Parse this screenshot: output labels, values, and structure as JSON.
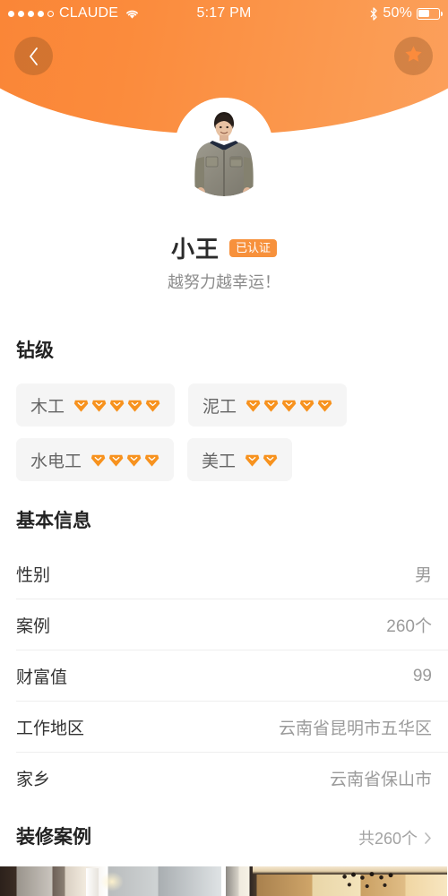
{
  "statusbar": {
    "signal_dots_filled": 4,
    "signal_dots_total": 5,
    "carrier": "CLAUDE",
    "wifi_icon": "wifi-icon",
    "time": "5:17 PM",
    "bluetooth_icon": "bluetooth-icon",
    "battery_percent": "50%",
    "battery_level": 50
  },
  "header": {
    "back_icon": "chevron-left-icon",
    "star_icon": "star-icon",
    "accent_color": "#fa8334",
    "gradient_end_color": "#fca261",
    "avatar_alt": "worker-portrait"
  },
  "profile": {
    "name": "小王",
    "verified_badge": "已认证",
    "tagline": "越努力越幸运！"
  },
  "diamond_section": {
    "title": "钻级",
    "gem_color": "#f7921e",
    "rows": [
      [
        {
          "label": "木工",
          "level": 5
        },
        {
          "label": "泥工",
          "level": 5
        }
      ],
      [
        {
          "label": "水电工",
          "level": 4
        },
        {
          "label": "美工",
          "level": 2
        }
      ]
    ]
  },
  "basic_info": {
    "title": "基本信息",
    "rows": [
      {
        "label": "性别",
        "value": "男"
      },
      {
        "label": "案例",
        "value": "260个"
      },
      {
        "label": "财富值",
        "value": "99"
      },
      {
        "label": "工作地区",
        "value": "云南省昆明市五华区"
      },
      {
        "label": "家乡",
        "value": "云南省保山市"
      }
    ]
  },
  "cases_section": {
    "title": "装修案例",
    "count_label": "共260个",
    "chevron_icon": "chevron-right-icon",
    "thumbnails": [
      {
        "alt": "bathroom-interior-photo"
      },
      {
        "alt": "lounge-chandelier-interior-photo"
      }
    ]
  }
}
